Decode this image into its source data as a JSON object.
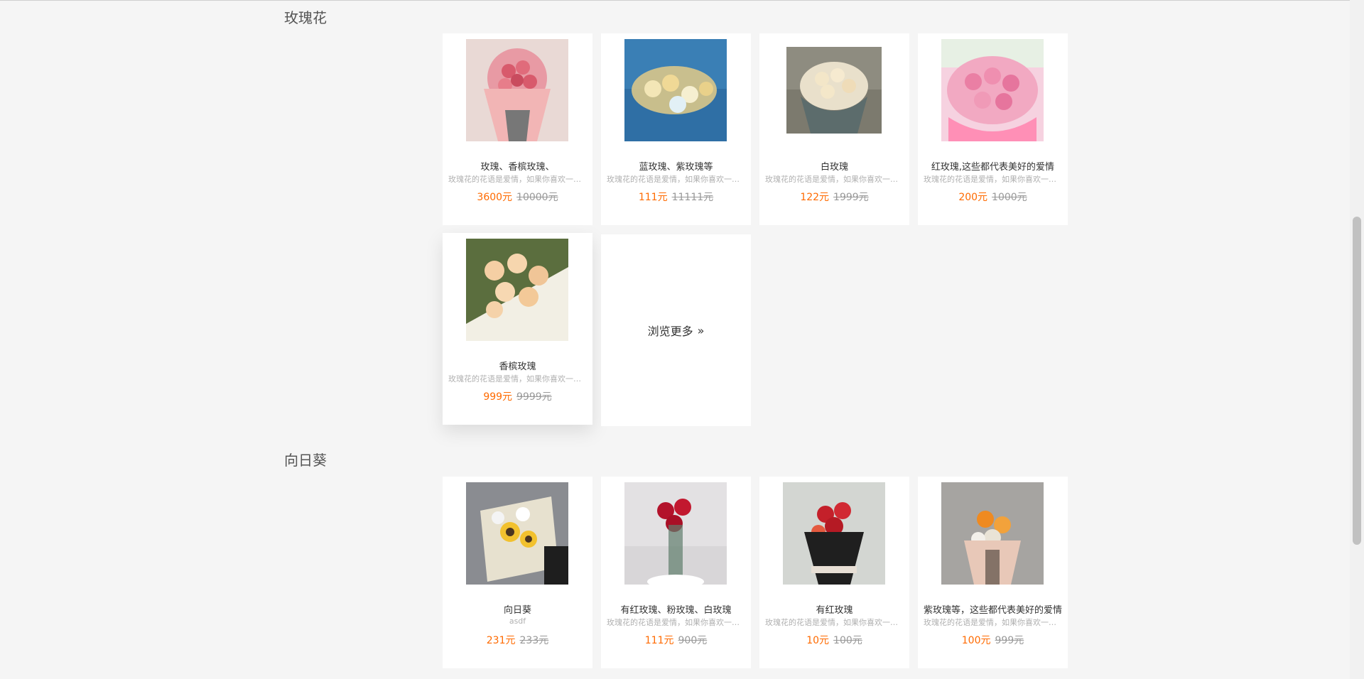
{
  "sections": [
    {
      "title": "玫瑰花",
      "products": [
        {
          "name": "玫瑰、香槟玫瑰、",
          "desc": "玫瑰花的花语是爱情，如果你喜欢一个人，就送他一束玫瑰花",
          "price": "3600元",
          "old_price": "10000元"
        },
        {
          "name": "蓝玫瑰、紫玫瑰等",
          "desc": "玫瑰花的花语是爱情，如果你喜欢一个人，就送他一束玫瑰花",
          "price": "111元",
          "old_price": "11111元"
        },
        {
          "name": "白玫瑰",
          "desc": "玫瑰花的花语是爱情，如果你喜欢一个人，就送他一束玫瑰花",
          "price": "122元",
          "old_price": "1999元"
        },
        {
          "name": "红玫瑰,这些都代表美好的爱情",
          "desc": "玫瑰花的花语是爱情，如果你喜欢一个人，就送他一束玫瑰花",
          "price": "200元",
          "old_price": "1000元"
        },
        {
          "name": "香槟玫瑰",
          "desc": "玫瑰花的花语是爱情，如果你喜欢一个人，就送他一束玫瑰花",
          "price": "999元",
          "old_price": "9999元"
        }
      ],
      "more_label": "浏览更多"
    },
    {
      "title": "向日葵",
      "products": [
        {
          "name": "向日葵",
          "desc": "asdf",
          "price": "231元",
          "old_price": "233元"
        },
        {
          "name": "有红玫瑰、粉玫瑰、白玫瑰",
          "desc": "玫瑰花的花语是爱情，如果你喜欢一个人，就送他一束玫瑰花",
          "price": "111元",
          "old_price": "900元"
        },
        {
          "name": "有红玫瑰",
          "desc": "玫瑰花的花语是爱情，如果你喜欢一个人，就送他一束玫瑰花",
          "price": "10元",
          "old_price": "100元"
        },
        {
          "name": "紫玫瑰等，这些都代表美好的爱情",
          "desc": "玫瑰花的花语是爱情，如果你喜欢一个人，就送他一束玫瑰花",
          "price": "100元",
          "old_price": "999元"
        }
      ]
    }
  ],
  "icons": {
    "more": "chevron-double-right-icon"
  }
}
